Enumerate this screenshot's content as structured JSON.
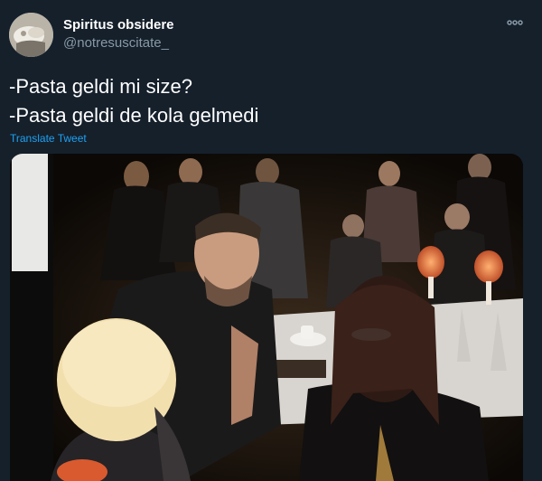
{
  "tweet": {
    "display_name": "Spiritus obsidere",
    "handle": "@notresuscitate_",
    "text_lines": [
      "-Pasta geldi mi size?",
      "-Pasta geldi de kola gelmedi"
    ],
    "translate_label": "Translate Tweet",
    "more_icon": "ellipsis-icon",
    "avatar_icon": "avatar-image"
  },
  "colors": {
    "background": "#15202b",
    "text_primary": "#ffffff",
    "text_secondary": "#8899a6",
    "link": "#1da1f2"
  }
}
